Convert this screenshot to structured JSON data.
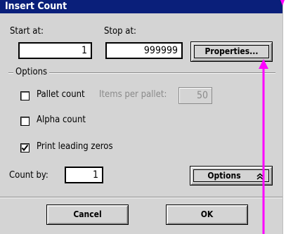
{
  "window": {
    "title": "Insert Count"
  },
  "start": {
    "label": "Start at:",
    "value": "1"
  },
  "stop": {
    "label": "Stop at:",
    "value": "999999"
  },
  "properties_button": {
    "label": "Properties..."
  },
  "options_group": {
    "label": "Options",
    "pallet_count": {
      "label": "Pallet count",
      "checked": false
    },
    "items_per_pallet": {
      "label": "Items per pallet:",
      "value": "50",
      "enabled": false
    },
    "alpha_count": {
      "label": "Alpha count",
      "checked": false
    },
    "leading_zeros": {
      "label": "Print leading zeros",
      "checked": true
    }
  },
  "count_by": {
    "label": "Count by:",
    "value": "1"
  },
  "options_button": {
    "label": "Options",
    "icon": "double-chevron-up-icon"
  },
  "footer": {
    "cancel_label": "Cancel",
    "ok_label": "OK"
  },
  "colors": {
    "title_bg": "#0a1f7a",
    "dialog_bg": "#d4d4d4",
    "annotation_pink": "#ff00ff"
  }
}
